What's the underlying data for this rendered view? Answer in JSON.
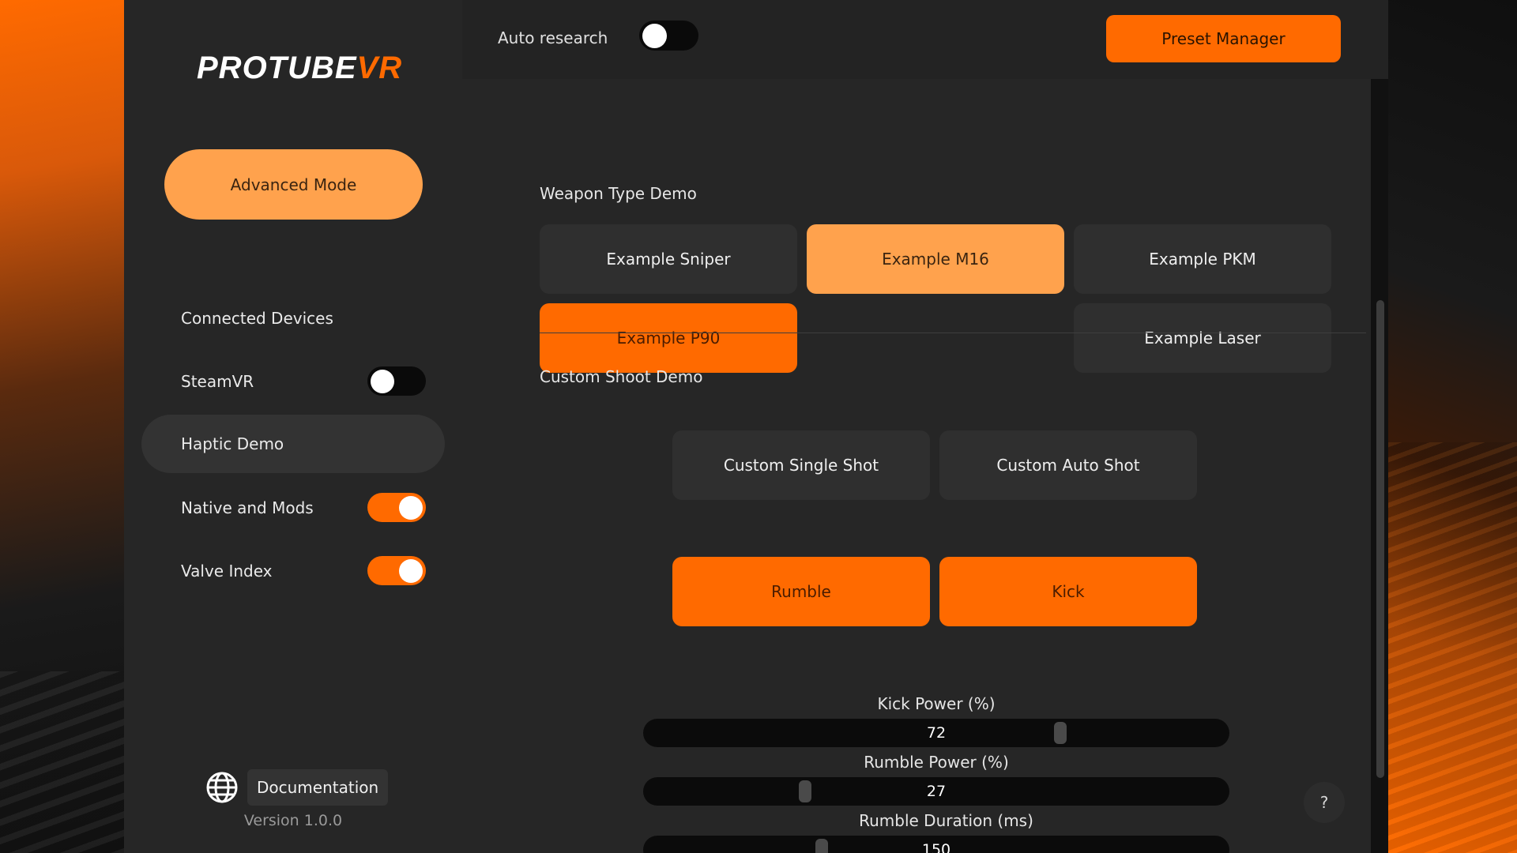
{
  "brand": {
    "logo_main": "PROTUBE",
    "logo_accent": "VR"
  },
  "sidebar": {
    "mode_button": "Advanced Mode",
    "items": [
      {
        "label": "Connected Devices",
        "toggle": null
      },
      {
        "label": "SteamVR",
        "toggle": "off"
      },
      {
        "label": "Haptic Demo",
        "toggle": null,
        "active": true
      },
      {
        "label": "Native and Mods",
        "toggle": "on"
      },
      {
        "label": "Valve Index",
        "toggle": "on"
      }
    ],
    "documentation": "Documentation",
    "version": "Version 1.0.0"
  },
  "topbar": {
    "auto_research_label": "Auto research",
    "auto_research_state": "off",
    "preset_manager": "Preset Manager"
  },
  "weapon_demo": {
    "title": "Weapon Type Demo",
    "buttons": {
      "sniper": "Example Sniper",
      "m16": "Example M16",
      "pkm": "Example PKM",
      "p90": "Example P90",
      "laser": "Example Laser"
    }
  },
  "custom_demo": {
    "title": "Custom Shoot Demo",
    "single": "Custom Single Shot",
    "auto": "Custom Auto Shot",
    "rumble": "Rumble",
    "kick": "Kick"
  },
  "sliders": {
    "kick_power": {
      "label": "Kick Power (%)",
      "value": "72"
    },
    "rumble_power": {
      "label": "Rumble Power (%)",
      "value": "27"
    },
    "rumble_duration": {
      "label": "Rumble Duration (ms)",
      "value": "150"
    }
  },
  "help": "?",
  "colors": {
    "accent": "#ff6a00",
    "accent_light": "#ffa24d",
    "panel": "#262626"
  }
}
